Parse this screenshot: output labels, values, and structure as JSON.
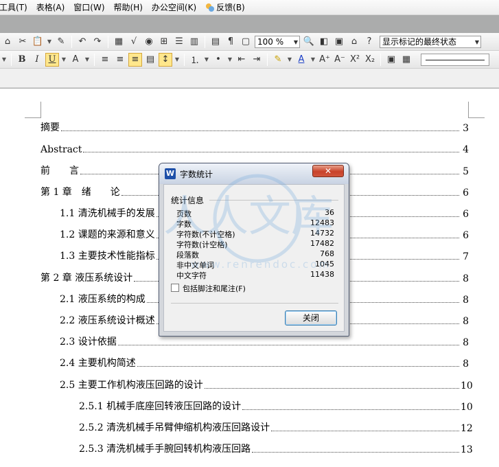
{
  "menu": [
    "工具(T)",
    "表格(A)",
    "窗口(W)",
    "帮助(H)",
    "办公空间(K)",
    "反馈(B)"
  ],
  "toolbar": {
    "zoom": "100 %",
    "revision_state": "显示标记的最终状态"
  },
  "format": {
    "bold": "B",
    "italic": "I",
    "underline": "U",
    "superscript": "X²",
    "subscript": "X₂"
  },
  "toc": [
    {
      "title": "摘要",
      "page": "3"
    },
    {
      "title": "Abstract",
      "page": "4"
    },
    {
      "title": "前　　言",
      "page": "5"
    },
    {
      "title": "第 1 章　绪　　论",
      "page": "6"
    },
    {
      "title": "1.1  清洗机械手的发展",
      "page": "6"
    },
    {
      "title": "1.2  课题的来源和意义",
      "page": "6"
    },
    {
      "title": "1.3 主要技术性能指标",
      "page": "7"
    },
    {
      "title": "第 2 章  液压系统设计",
      "page": "8"
    },
    {
      "title": "2.1  液压系统的构成",
      "page": "8"
    },
    {
      "title": "2.2 液压系统设计概述",
      "page": "8"
    },
    {
      "title": "2.3  设计依据",
      "page": "8"
    },
    {
      "title": "2.4  主要机构简述",
      "page": "8"
    },
    {
      "title": "2.5  主要工作机构液压回路的设计",
      "page": "10"
    },
    {
      "title": "2.5.1 机械手底座回转液压回路的设计",
      "page": "10"
    },
    {
      "title": "2.5.2 清洗机械手吊臂伸缩机构液压回路设计",
      "page": "12"
    },
    {
      "title": "2.5.3 清洗机械手手腕回转机构液压回路",
      "page": "13"
    }
  ],
  "dialog": {
    "title": "字数统计",
    "close_x": "✕",
    "group": "统计信息",
    "stats": [
      {
        "label": "页数",
        "value": "36"
      },
      {
        "label": "字数",
        "value": "12483"
      },
      {
        "label": "字符数(不计空格)",
        "value": "14732"
      },
      {
        "label": "字符数(计空格)",
        "value": "17482"
      },
      {
        "label": "段落数",
        "value": "768"
      },
      {
        "label": "非中文单词",
        "value": "1045"
      },
      {
        "label": "中文字符",
        "value": "11438"
      }
    ],
    "include_footnotes": "包括脚注和尾注(F)",
    "close_button": "关闭"
  },
  "watermark": {
    "text": "人人文库",
    "url": "www.renrendoc.com"
  }
}
